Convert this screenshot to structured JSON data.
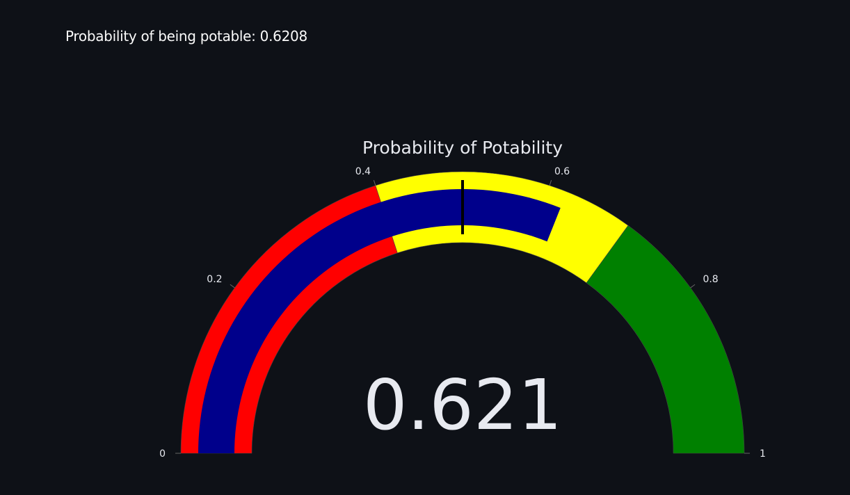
{
  "result": {
    "text": "Probability of being potable: 0.6208"
  },
  "chart_data": {
    "type": "gauge",
    "title": "Probability of Potability",
    "value": 0.6208,
    "value_label": "0.621",
    "range": [
      0,
      1
    ],
    "threshold": 0.5,
    "ticks": [
      {
        "value": 0,
        "label": "0"
      },
      {
        "value": 0.2,
        "label": "0.2"
      },
      {
        "value": 0.4,
        "label": "0.4"
      },
      {
        "value": 0.6,
        "label": "0.6"
      },
      {
        "value": 0.8,
        "label": "0.8"
      },
      {
        "value": 1,
        "label": "1"
      }
    ],
    "steps": [
      {
        "range": [
          0,
          0.4
        ],
        "color": "#ff0000"
      },
      {
        "range": [
          0.4,
          0.7
        ],
        "color": "#ffff00"
      },
      {
        "range": [
          0.7,
          1
        ],
        "color": "#008000"
      }
    ],
    "bar_color": "#00008b",
    "threshold_color": "#000000",
    "background_color": "#0e1117",
    "text_color": "#fafafa"
  }
}
